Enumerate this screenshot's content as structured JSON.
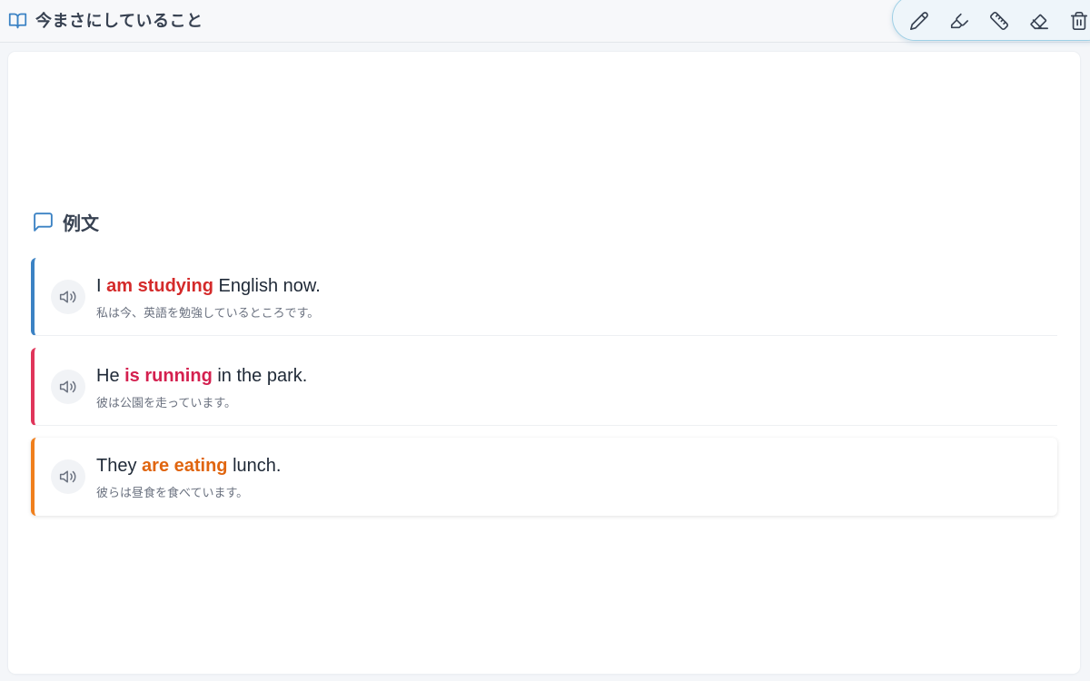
{
  "header": {
    "title": "今まさにしていること",
    "icon": "book-open-icon",
    "icon_color": "#3b82c4"
  },
  "toolbar": {
    "tools": [
      {
        "name": "pencil-icon"
      },
      {
        "name": "highlighter-icon"
      },
      {
        "name": "ruler-icon"
      },
      {
        "name": "eraser-icon"
      },
      {
        "name": "trash-icon"
      }
    ]
  },
  "section": {
    "title": "例文",
    "icon": "message-square-icon",
    "icon_color": "#3b82c4"
  },
  "examples": [
    {
      "before": "I ",
      "highlight": "am studying",
      "after": " English now.",
      "translation": "私は今、英語を勉強しているところです。",
      "accent": "#3b82c4",
      "highlight_color": "#d42a2a"
    },
    {
      "before": "He ",
      "highlight": "is running",
      "after": " in the park.",
      "translation": "彼は公園を走っています。",
      "accent": "#e0355a",
      "highlight_color": "#d4204f"
    },
    {
      "before": "They ",
      "highlight": "are eating",
      "after": " lunch.",
      "translation": "彼らは昼食を食べています。",
      "accent": "#f07f1c",
      "highlight_color": "#e0650f"
    }
  ]
}
